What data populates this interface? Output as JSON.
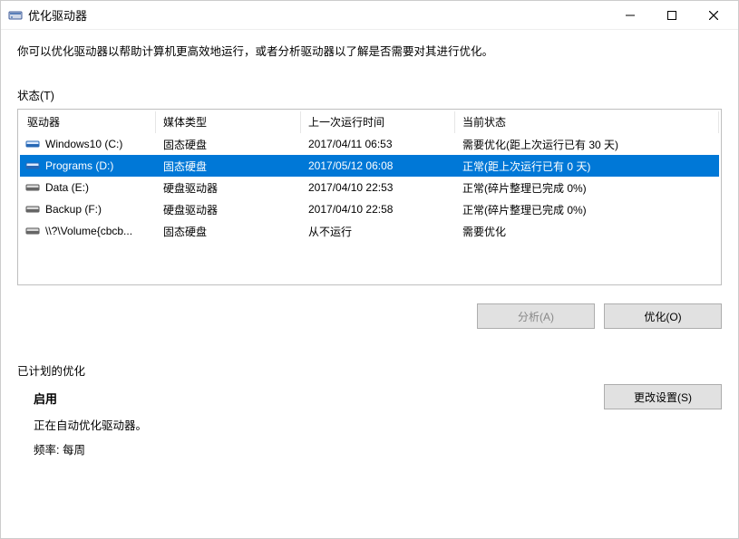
{
  "window": {
    "title": "优化驱动器"
  },
  "description": "你可以优化驱动器以帮助计算机更高效地运行，或者分析驱动器以了解是否需要对其进行优化。",
  "statusLabel": "状态(T)",
  "columns": {
    "drive": "驱动器",
    "media": "媒体类型",
    "last": "上一次运行时间",
    "status": "当前状态"
  },
  "rows": [
    {
      "name": "Windows10 (C:)",
      "media": "固态硬盘",
      "last": "2017/04/11 06:53",
      "status": "需要优化(距上次运行已有 30 天)",
      "iconType": "ssd",
      "selected": false
    },
    {
      "name": "Programs (D:)",
      "media": "固态硬盘",
      "last": "2017/05/12 06:08",
      "status": "正常(距上次运行已有 0 天)",
      "iconType": "ssd",
      "selected": true
    },
    {
      "name": "Data (E:)",
      "media": "硬盘驱动器",
      "last": "2017/04/10 22:53",
      "status": "正常(碎片整理已完成 0%)",
      "iconType": "hdd",
      "selected": false
    },
    {
      "name": "Backup (F:)",
      "media": "硬盘驱动器",
      "last": "2017/04/10 22:58",
      "status": "正常(碎片整理已完成 0%)",
      "iconType": "hdd",
      "selected": false
    },
    {
      "name": "\\\\?\\Volume{cbcb...",
      "media": "固态硬盘",
      "last": "从不运行",
      "status": "需要优化",
      "iconType": "hdd",
      "selected": false
    }
  ],
  "buttons": {
    "analyze": "分析(A)",
    "optimize": "优化(O)",
    "changeSettings": "更改设置(S)"
  },
  "scheduleLabel": "已计划的优化",
  "schedule": {
    "enabled": "启用",
    "desc": "正在自动优化驱动器。",
    "freqLabel": "频率:",
    "freqValue": "每周"
  }
}
